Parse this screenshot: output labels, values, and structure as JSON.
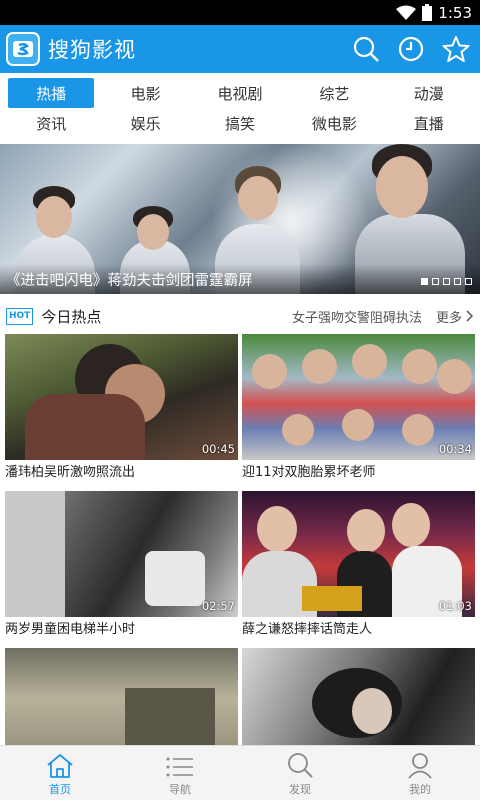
{
  "status": {
    "time": "1:53"
  },
  "app": {
    "title": "搜狗影视"
  },
  "header_actions": [
    {
      "icon": "search-icon"
    },
    {
      "icon": "history-clock-icon"
    },
    {
      "icon": "favorite-star-icon"
    }
  ],
  "categories": {
    "row1": [
      "热播",
      "电影",
      "电视剧",
      "综艺",
      "动漫"
    ],
    "row2": [
      "资讯",
      "娱乐",
      "搞笑",
      "微电影",
      "直播"
    ],
    "active": "热播"
  },
  "banner": {
    "caption": "《进击吧闪电》蒋劲夫击剑团雷霆霸屏",
    "slide_count": 5,
    "active_slide": 1
  },
  "hot": {
    "badge": "HOT",
    "title": "今日热点",
    "headline": "女子强吻交警阻碍执法",
    "more": "更多"
  },
  "videos": [
    {
      "caption": "潘玮柏吴昕激吻照流出",
      "duration": "00:45"
    },
    {
      "caption": "迎11对双胞胎累坏老师",
      "duration": "00:34"
    },
    {
      "caption": "两岁男童困电梯半小时",
      "duration": "02:57"
    },
    {
      "caption": "薛之谦怒摔摔话筒走人",
      "duration": "01:03"
    },
    {
      "caption": "",
      "duration": ""
    },
    {
      "caption": "",
      "duration": ""
    }
  ],
  "bottom_nav": [
    {
      "label": "首页",
      "icon": "home-icon",
      "active": true
    },
    {
      "label": "导航",
      "icon": "list-icon",
      "active": false
    },
    {
      "label": "发现",
      "icon": "search-icon",
      "active": false
    },
    {
      "label": "我的",
      "icon": "user-icon",
      "active": false
    }
  ],
  "colors": {
    "accent": "#1996e6",
    "status_bar": "#000000"
  }
}
